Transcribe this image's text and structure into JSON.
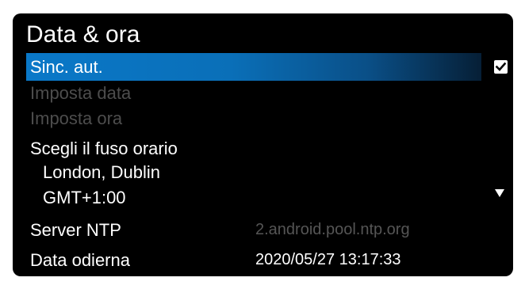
{
  "screen": {
    "title": "Data & ora"
  },
  "settings": {
    "auto_sync": {
      "label": "Sinc. aut.",
      "checked": true
    },
    "set_date": {
      "label": "Imposta data"
    },
    "set_time": {
      "label": "Imposta ora"
    },
    "timezone": {
      "label": "Scegli il fuso orario",
      "city": "London, Dublin",
      "offset": "GMT+1:00"
    },
    "ntp_server": {
      "label": "Server NTP",
      "value": "2.android.pool.ntp.org"
    },
    "current_date": {
      "label": "Data odierna",
      "value": "2020/05/27 13:17:33"
    }
  },
  "colors": {
    "background": "#000000",
    "highlight": "#0a78c8",
    "text": "#ffffff",
    "disabled_text": "#4d4d4d"
  },
  "icons": {
    "checkbox": "checkbox-checked-icon",
    "dropdown": "dropdown-arrow-icon"
  }
}
